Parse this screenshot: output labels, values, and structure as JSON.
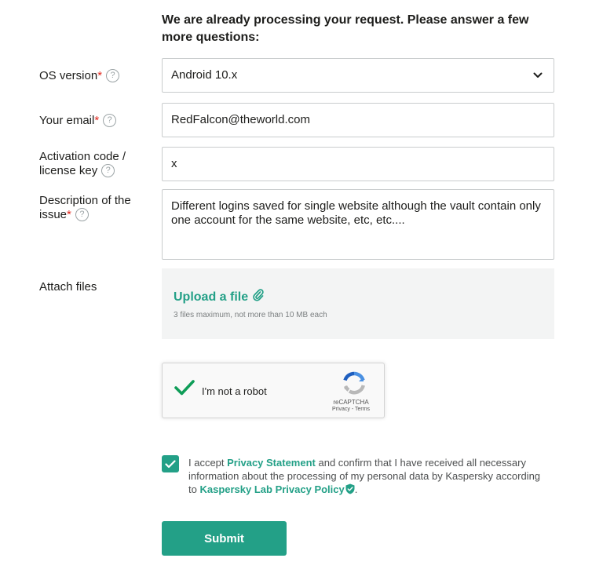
{
  "form": {
    "heading": "We are already processing your request. Please answer a few more questions:",
    "required_mark": "*",
    "help_icon_glyph": "?",
    "fields": {
      "os_version": {
        "label": "OS version",
        "value": "Android 10.x",
        "icon": "chevron-down-icon"
      },
      "email": {
        "label": "Your email",
        "value": "RedFalcon@theworld.com"
      },
      "activation_code": {
        "label_line1": "Activation code /",
        "label_line2": "license key",
        "value": "x"
      },
      "description": {
        "label_line1": "Description of the",
        "label_line2": "issue",
        "value": "Different logins saved for single website although the vault contain only one account for the same website, etc, etc...."
      }
    },
    "attach": {
      "label": "Attach files",
      "upload_link": "Upload a file",
      "note": "3 files maximum, not more than 10 MB each"
    },
    "captcha": {
      "label": "I'm not a robot",
      "brand": "reCAPTCHA",
      "privacy": "Privacy",
      "separator": " - ",
      "terms": "Terms",
      "checked": true
    },
    "consent": {
      "checked": true,
      "part1": "I accept ",
      "privacy_link": "Privacy Statement",
      "part2": " and confirm that I have received all necessary information about the processing of my personal data by Kaspersky according to ",
      "policy_link": "Kaspersky Lab Privacy Policy",
      "part3": "."
    },
    "submit_label": "Submit"
  },
  "colors": {
    "accent": "#23a087",
    "required": "#e2261c",
    "text": "#1d1d1b",
    "border": "#c9cccd",
    "upload_bg": "#f3f4f4"
  }
}
